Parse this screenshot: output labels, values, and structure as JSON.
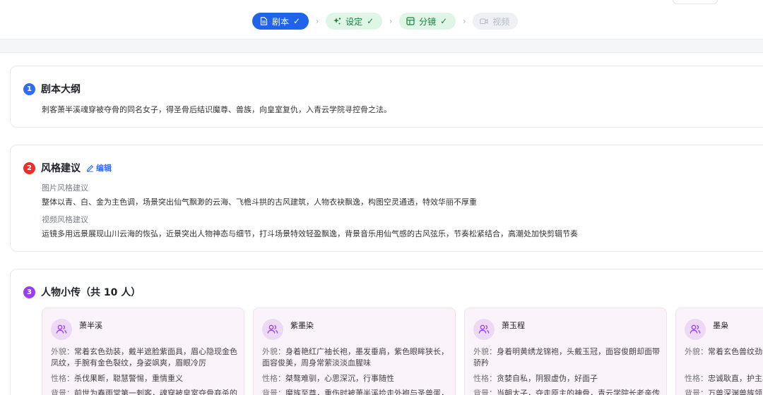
{
  "steps": [
    {
      "label": "剧本",
      "check": "✓",
      "state": "active",
      "icon": "document-icon"
    },
    {
      "label": "设定",
      "check": "✓",
      "state": "done",
      "icon": "sparkle-icon"
    },
    {
      "label": "分镜",
      "check": "✓",
      "state": "done",
      "icon": "storyboard-icon"
    },
    {
      "label": "视频",
      "check": "",
      "state": "disabled",
      "icon": "video-icon"
    }
  ],
  "separators": [
    "›",
    "›",
    "›"
  ],
  "outline": {
    "number": "1",
    "title": "剧本大纲",
    "text": "刺客萧半溪魂穿被夺骨的同名女子，得圣骨后结识魔尊、兽族，向皇室复仇，入青云学院寻控骨之法。"
  },
  "style": {
    "number": "2",
    "title": "风格建议",
    "edit_label": "编辑",
    "image_label": "图片风格建议",
    "image_text": "整体以青、白、金为主色调，场景突出仙气飘渺的云海、飞檐斗拱的古风建筑，人物衣袂飘逸，构图空灵通透，特效华丽不厚重",
    "video_label": "视频风格建议",
    "video_text": "运镜多用远景展现山川云海的恢弘，近景突出人物神态与细节，打斗场景特效轻盈飘逸，背景音乐用仙气感的古风弦乐，节奏松紧结合，高潮处加快剪辑节奏"
  },
  "characters": {
    "number": "3",
    "title": "人物小传（共 10 人）",
    "keys": {
      "appearance": "外貌：",
      "personality": "性格：",
      "background": "背景："
    },
    "items": [
      {
        "name": "萧半溪",
        "appearance": "常着玄色劲装，戴半遮脸紫面具，眉心隐现金色凤纹，手腕有金色裂纹，身姿飒爽，眉眼冷厉",
        "personality": "杀伐果断，聪慧警惕，重情重义",
        "background": "前世为春雨堂第一刺客，魂穿被皇室夺骨弃杀的"
      },
      {
        "name": "紫墨染",
        "appearance": "身着艳红广袖长袍，墨发垂肩，紫色眼眸狭长，面容俊美，周身常萦淡淡血腥味",
        "personality": "桀骜难驯，心思深沉，行事随性",
        "background": "魔族至尊，重伤时被萧半溪捡走外袍与圣兽蛋，"
      },
      {
        "name": "萧玉程",
        "appearance": "身着明黄绣龙锦袍，头戴玉冠，面容俊朗却面带骄矜",
        "personality": "贪婪自私，阴狠虚伪，好面子",
        "background": "当朝太子，夺走原主的神骨，青云学院长老亲传"
      },
      {
        "name": "墨枭",
        "appearance": "常着玄色兽纹劲装，兽瞳冷冽，气势慑人",
        "personality": "忠诚耿直，护主心切",
        "background": "万兽深渊兽族领主"
      }
    ]
  }
}
